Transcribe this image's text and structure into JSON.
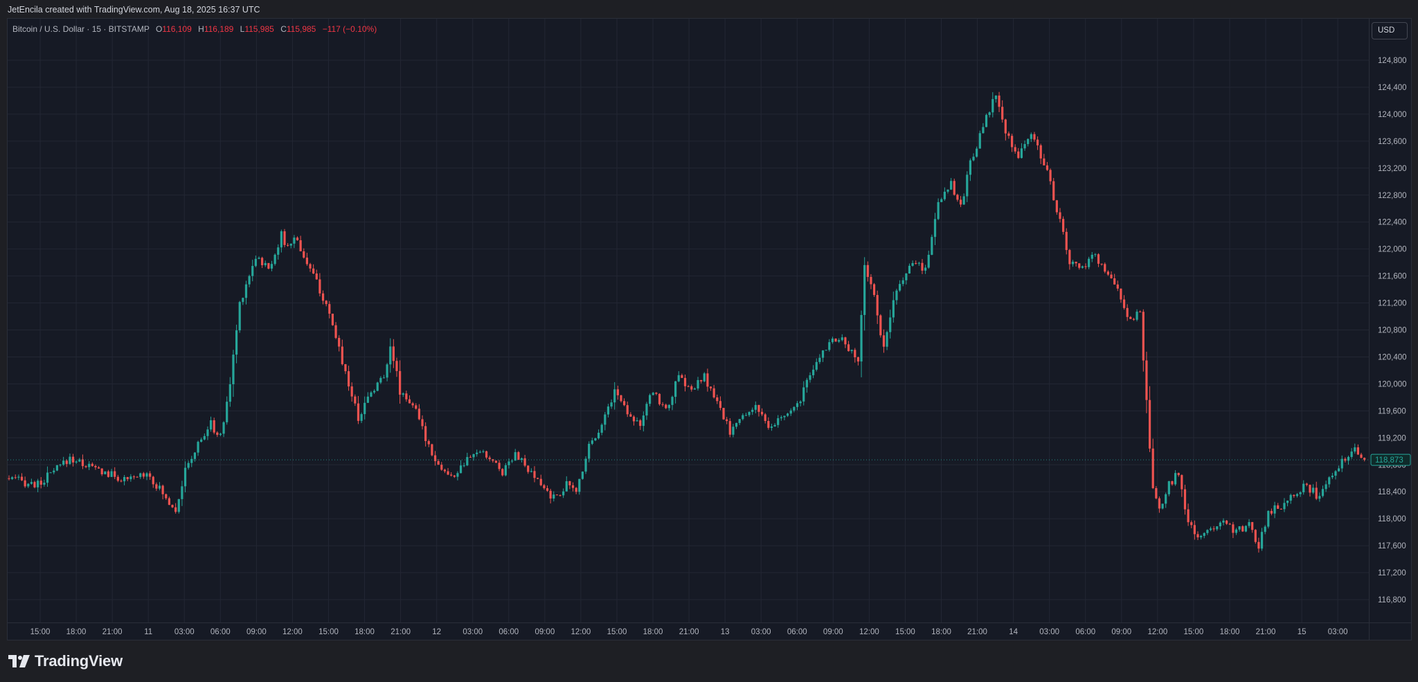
{
  "header": {
    "attribution": "JetEncila created with TradingView.com, Aug 18, 2025 16:37 UTC"
  },
  "legend": {
    "symbol": "Bitcoin / U.S. Dollar · 15 · BITSTAMP",
    "open_label": "O",
    "open": "116,109",
    "high_label": "H",
    "high": "116,189",
    "low_label": "L",
    "low": "115,985",
    "close_label": "C",
    "close": "115,985",
    "change": "−117 (−0.10%)"
  },
  "price_scale": {
    "currency": "USD",
    "last_price": "118,873"
  },
  "footer": {
    "brand": "TradingView",
    "logo_icon": "tradingview-logo-icon"
  },
  "colors": {
    "up": "#26a69a",
    "down": "#ef5350",
    "background": "#161a25",
    "grid": "#232734",
    "text": "#b2b5be"
  },
  "chart_data": {
    "type": "candlestick",
    "symbol": "Bitcoin / U.S. Dollar",
    "interval": "15",
    "exchange": "BITSTAMP",
    "ylim": [
      116500,
      125000
    ],
    "y_ticks": [
      116800,
      117200,
      117600,
      118000,
      118400,
      118800,
      119200,
      119600,
      120000,
      120400,
      120800,
      121200,
      121600,
      122000,
      122400,
      122800,
      123200,
      123600,
      124000,
      124400,
      124800
    ],
    "y_tick_labels": [
      "116,800",
      "117,200",
      "117,600",
      "118,000",
      "118,400",
      "118,800",
      "119,200",
      "119,600",
      "120,000",
      "120,400",
      "120,800",
      "121,200",
      "121,600",
      "122,000",
      "122,400",
      "122,800",
      "123,200",
      "123,600",
      "124,000",
      "124,400",
      "124,800"
    ],
    "x_tick_labels": [
      "15:00",
      "18:00",
      "21:00",
      "11",
      "03:00",
      "06:00",
      "09:00",
      "12:00",
      "15:00",
      "18:00",
      "21:00",
      "12",
      "03:00",
      "06:00",
      "09:00",
      "12:00",
      "15:00",
      "18:00",
      "21:00",
      "13",
      "03:00",
      "06:00",
      "09:00",
      "12:00",
      "15:00",
      "18:00",
      "21:00",
      "14",
      "03:00",
      "06:00",
      "09:00",
      "12:00",
      "15:00",
      "18:00",
      "21:00",
      "15",
      "03:00"
    ],
    "grid": true,
    "last_price": 118873,
    "price_path": [
      [
        0,
        118600
      ],
      [
        10,
        118500
      ],
      [
        20,
        118900
      ],
      [
        30,
        118700
      ],
      [
        38,
        118550
      ],
      [
        44,
        118700
      ],
      [
        50,
        118300
      ],
      [
        53,
        118150
      ],
      [
        56,
        118700
      ],
      [
        60,
        119100
      ],
      [
        64,
        119400
      ],
      [
        67,
        119200
      ],
      [
        70,
        120000
      ],
      [
        73,
        121200
      ],
      [
        78,
        121900
      ],
      [
        82,
        121700
      ],
      [
        86,
        122200
      ],
      [
        88,
        122000
      ],
      [
        90,
        122200
      ],
      [
        94,
        121800
      ],
      [
        98,
        121400
      ],
      [
        103,
        120700
      ],
      [
        107,
        120000
      ],
      [
        110,
        119500
      ],
      [
        114,
        119900
      ],
      [
        118,
        120100
      ],
      [
        120,
        120600
      ],
      [
        123,
        119900
      ],
      [
        127,
        119700
      ],
      [
        131,
        119200
      ],
      [
        135,
        118800
      ],
      [
        139,
        118600
      ],
      [
        143,
        118800
      ],
      [
        147,
        119000
      ],
      [
        151,
        118900
      ],
      [
        155,
        118700
      ],
      [
        159,
        119000
      ],
      [
        163,
        118700
      ],
      [
        167,
        118500
      ],
      [
        171,
        118300
      ],
      [
        175,
        118500
      ],
      [
        178,
        118400
      ],
      [
        182,
        119100
      ],
      [
        186,
        119400
      ],
      [
        190,
        119900
      ],
      [
        194,
        119600
      ],
      [
        198,
        119400
      ],
      [
        202,
        119900
      ],
      [
        206,
        119600
      ],
      [
        210,
        120100
      ],
      [
        214,
        119900
      ],
      [
        218,
        120100
      ],
      [
        222,
        119700
      ],
      [
        226,
        119300
      ],
      [
        230,
        119500
      ],
      [
        234,
        119700
      ],
      [
        238,
        119300
      ],
      [
        242,
        119500
      ],
      [
        246,
        119600
      ],
      [
        250,
        120000
      ],
      [
        254,
        120400
      ],
      [
        258,
        120700
      ],
      [
        262,
        120600
      ],
      [
        266,
        120300
      ],
      [
        268,
        121800
      ],
      [
        271,
        121300
      ],
      [
        274,
        120500
      ],
      [
        277,
        121200
      ],
      [
        280,
        121600
      ],
      [
        284,
        121800
      ],
      [
        287,
        121700
      ],
      [
        291,
        122700
      ],
      [
        295,
        123000
      ],
      [
        298,
        122600
      ],
      [
        301,
        123300
      ],
      [
        305,
        123800
      ],
      [
        309,
        124300
      ],
      [
        312,
        123700
      ],
      [
        316,
        123400
      ],
      [
        320,
        123700
      ],
      [
        324,
        123300
      ],
      [
        328,
        122600
      ],
      [
        332,
        121800
      ],
      [
        336,
        121700
      ],
      [
        340,
        121900
      ],
      [
        344,
        121600
      ],
      [
        348,
        121300
      ],
      [
        351,
        120900
      ],
      [
        354,
        121100
      ],
      [
        356,
        119700
      ],
      [
        358,
        118400
      ],
      [
        360,
        118100
      ],
      [
        363,
        118500
      ],
      [
        366,
        118700
      ],
      [
        369,
        117900
      ],
      [
        373,
        117700
      ],
      [
        377,
        117900
      ],
      [
        380,
        118000
      ],
      [
        384,
        117800
      ],
      [
        388,
        117900
      ],
      [
        391,
        117600
      ],
      [
        394,
        118100
      ],
      [
        398,
        118200
      ],
      [
        402,
        118400
      ],
      [
        406,
        118500
      ],
      [
        410,
        118300
      ],
      [
        414,
        118700
      ],
      [
        418,
        118900
      ],
      [
        421,
        119100
      ],
      [
        423,
        118900
      ]
    ]
  }
}
